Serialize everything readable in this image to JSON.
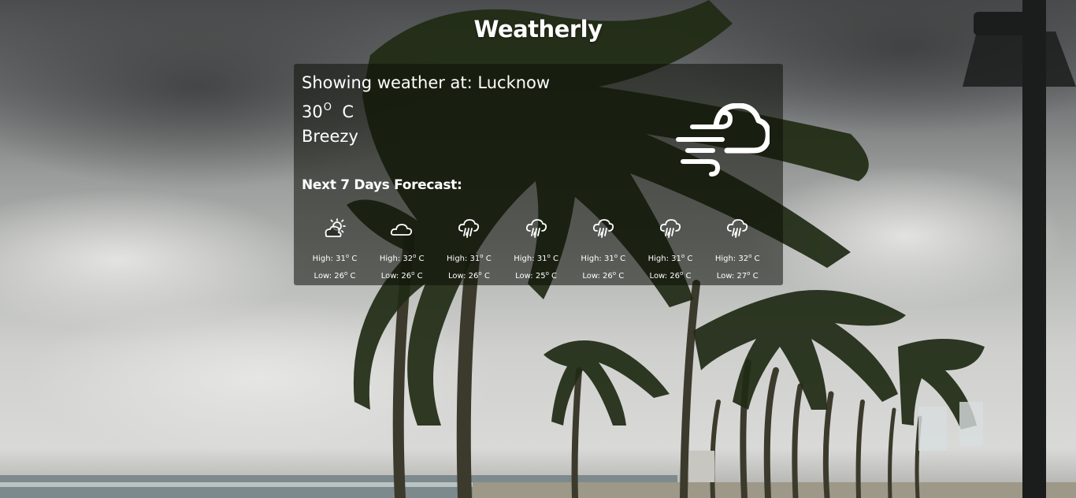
{
  "app": {
    "title": "Weatherly"
  },
  "current": {
    "location_label": "Showing weather at: Lucknow",
    "temperature": "30",
    "degree_symbol": "O",
    "unit": "C",
    "summary": "Breezy",
    "icon": "wind-cloud-icon"
  },
  "forecast": {
    "title": "Next 7 Days Forecast:",
    "high_prefix": "High: ",
    "low_prefix": "Low: ",
    "degree_symbol": "o",
    "unit": "C",
    "days": [
      {
        "icon": "partly-sunny-icon",
        "high": "31",
        "low": "26"
      },
      {
        "icon": "cloud-icon",
        "high": "32",
        "low": "26"
      },
      {
        "icon": "rain-cloud-icon",
        "high": "31",
        "low": "26"
      },
      {
        "icon": "rain-cloud-icon",
        "high": "31",
        "low": "25"
      },
      {
        "icon": "rain-cloud-icon",
        "high": "31",
        "low": "26"
      },
      {
        "icon": "rain-cloud-icon",
        "high": "31",
        "low": "26"
      },
      {
        "icon": "rain-cloud-icon",
        "high": "32",
        "low": "27"
      }
    ]
  },
  "colors": {
    "text": "#ffffff",
    "card_bg": "rgba(12,16,8,0.55)"
  }
}
